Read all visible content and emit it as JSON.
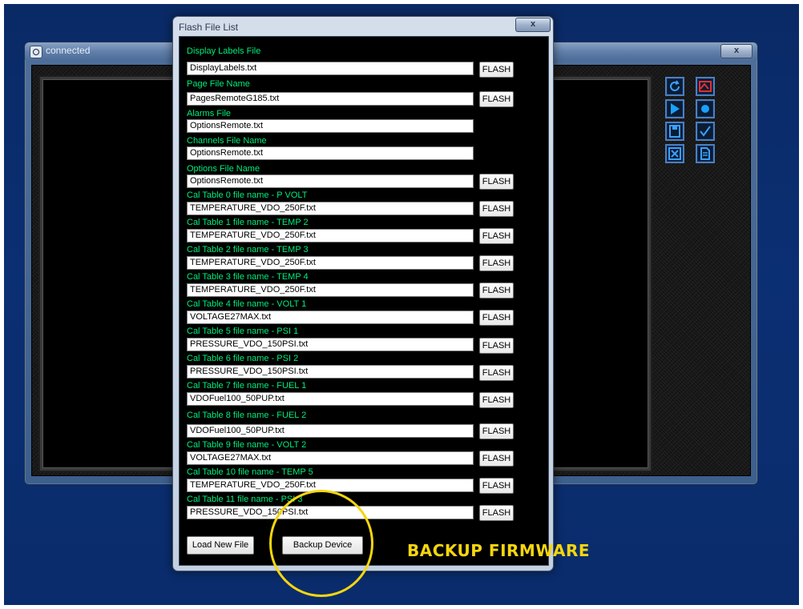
{
  "back_window": {
    "title": "connected",
    "close_label": "x"
  },
  "toolbar": {
    "icons": [
      "refresh-icon",
      "chart-icon",
      "play-icon",
      "record-icon",
      "save-icon",
      "check-icon",
      "close-box-icon",
      "document-icon"
    ]
  },
  "dialog": {
    "title": "Flash File List",
    "close_label": "x",
    "flash_label": "FLASH",
    "fields": [
      {
        "label": "Display Labels File",
        "value": "DisplayLabels.txt"
      },
      {
        "label": "Page File Name",
        "value": "PagesRemoteG185.txt"
      },
      {
        "label": "Alarms File",
        "value": "OptionsRemote.txt"
      },
      {
        "label": "Channels File Name",
        "value": "OptionsRemote.txt"
      },
      {
        "label": "Options File Name",
        "value": "OptionsRemote.txt"
      },
      {
        "label": "Cal Table 0 file name  - P VOLT",
        "value": "TEMPERATURE_VDO_250F.txt"
      },
      {
        "label": "Cal Table 1 file name  - TEMP 2",
        "value": "TEMPERATURE_VDO_250F.txt"
      },
      {
        "label": "Cal Table 2 file name  - TEMP 3",
        "value": "TEMPERATURE_VDO_250F.txt"
      },
      {
        "label": "Cal Table 3 file name  - TEMP 4",
        "value": "TEMPERATURE_VDO_250F.txt"
      },
      {
        "label": "Cal Table 4 file name  - VOLT 1",
        "value": "VOLTAGE27MAX.txt"
      },
      {
        "label": "Cal Table 5 file name  - PSI 1",
        "value": "PRESSURE_VDO_150PSI.txt"
      },
      {
        "label": "Cal Table 6 file name  - PSI 2",
        "value": "PRESSURE_VDO_150PSI.txt"
      },
      {
        "label": "Cal Table 7 file name  - FUEL 1",
        "value": "VDOFuel100_50PUP.txt"
      },
      {
        "label": "Cal Table 8 file name  - FUEL 2",
        "value": "VDOFuel100_50PUP.txt"
      },
      {
        "label": "Cal Table 9 file name  - VOLT 2",
        "value": "VOLTAGE27MAX.txt"
      },
      {
        "label": "Cal Table 10 file name  - TEMP 5",
        "value": "TEMPERATURE_VDO_250F.txt"
      },
      {
        "label": "Cal Table 11 file name  - PSI 3",
        "value": "PRESSURE_VDO_150PSI.txt"
      }
    ],
    "load_button": "Load New File",
    "backup_button": "Backup Device"
  },
  "annotation": {
    "text": "BACKUP FIRMWARE",
    "color": "#f5d60e"
  },
  "colors": {
    "label_green": "#00ee7a",
    "desktop_blue": "#0a2a66"
  }
}
